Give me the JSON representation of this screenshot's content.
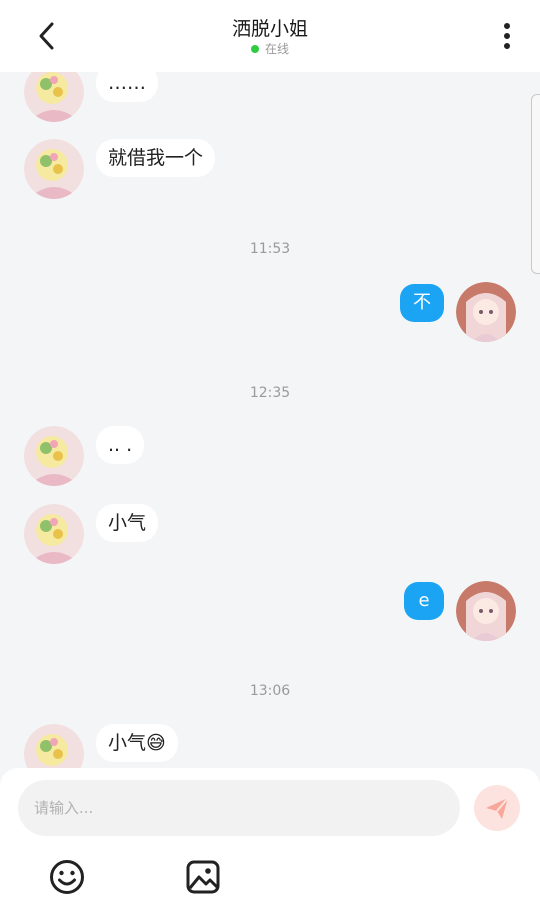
{
  "header": {
    "title": "洒脱小姐",
    "status": "在线"
  },
  "messages": [
    {
      "side": "in",
      "text": "……"
    },
    {
      "side": "in",
      "text": "就借我一个"
    },
    {
      "time": "11:53"
    },
    {
      "side": "out",
      "text": "不"
    },
    {
      "time": "12:35"
    },
    {
      "side": "in",
      "text": ".. ."
    },
    {
      "side": "in",
      "text": "小气"
    },
    {
      "side": "out",
      "text": "e"
    },
    {
      "time": "13:06"
    },
    {
      "side": "in",
      "text": "小气😅"
    }
  ],
  "footer": {
    "input_placeholder": "请输入...",
    "input_value": ""
  },
  "icons": {
    "back": "back-arrow-icon",
    "more": "more-vertical-icon",
    "send": "send-icon",
    "emoji": "emoji-icon",
    "image": "image-icon"
  },
  "colors": {
    "accent_blue": "#1ba4f3",
    "online_green": "#2ecc40",
    "send_bg": "#fde3df",
    "send_icon": "#f8a89b",
    "background": "#f4f5f7"
  }
}
